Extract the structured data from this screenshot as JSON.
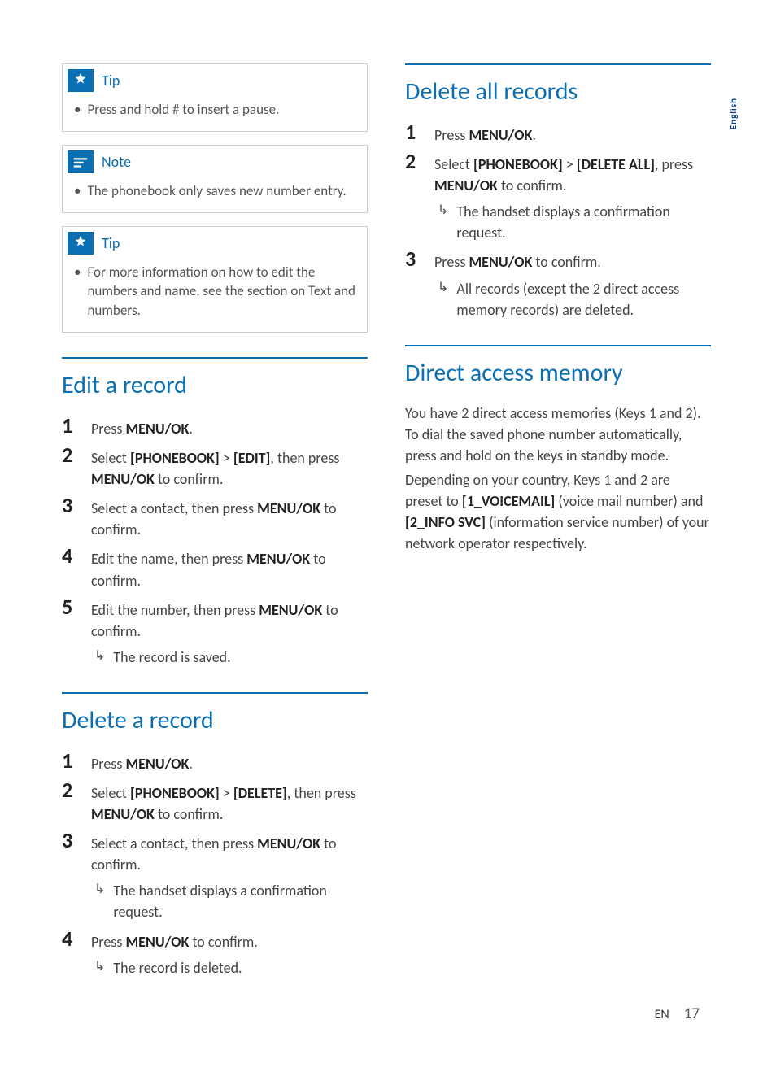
{
  "sideTab": "English",
  "callouts": {
    "tip1": {
      "label": "Tip",
      "text": "Press and hold # to insert a pause."
    },
    "note1": {
      "label": "Note",
      "text": "The phonebook only saves new number entry."
    },
    "tip2": {
      "label": "Tip",
      "text": "For more information on how to edit the numbers and name, see the section on Text and numbers."
    }
  },
  "sections": {
    "editRecord": {
      "title": "Edit a record",
      "steps": {
        "s1": {
          "pre": "Press ",
          "b1": "MENU/OK",
          "post": "."
        },
        "s2": {
          "pre": "Select ",
          "b1": "[PHONEBOOK]",
          "mid1": " > ",
          "b2": "[EDIT]",
          "mid2": ", then press ",
          "b3": "MENU/OK",
          "post": " to confirm."
        },
        "s3": {
          "pre": "Select a contact, then press ",
          "b1": "MENU/OK",
          "post": " to confirm."
        },
        "s4": {
          "pre": "Edit the name, then press ",
          "b1": "MENU/OK",
          "post": " to confirm."
        },
        "s5": {
          "pre": "Edit the number, then press ",
          "b1": "MENU/OK",
          "post": " to confirm.",
          "result": "The record is saved."
        }
      }
    },
    "deleteRecord": {
      "title": "Delete a record",
      "steps": {
        "s1": {
          "pre": "Press ",
          "b1": "MENU/OK",
          "post": "."
        },
        "s2": {
          "pre": "Select ",
          "b1": "[PHONEBOOK]",
          "mid1": " > ",
          "b2": "[DELETE]",
          "mid2": ", then press ",
          "b3": "MENU/OK",
          "post": " to confirm."
        },
        "s3": {
          "pre": "Select a contact, then press ",
          "b1": "MENU/OK",
          "post": " to confirm.",
          "result": "The handset displays a confirmation request."
        },
        "s4": {
          "pre": "Press ",
          "b1": "MENU/OK",
          "post": " to confirm.",
          "result": "The record is deleted."
        }
      }
    },
    "deleteAll": {
      "title": "Delete all records",
      "steps": {
        "s1": {
          "pre": "Press ",
          "b1": "MENU/OK",
          "post": "."
        },
        "s2": {
          "pre": "Select ",
          "b1": "[PHONEBOOK]",
          "mid1": " > ",
          "b2": "[DELETE ALL]",
          "mid2": ", press ",
          "b3": "MENU/OK",
          "post": " to confirm.",
          "result": "The handset displays a confirmation request."
        },
        "s3": {
          "pre": "Press ",
          "b1": "MENU/OK",
          "post": " to confirm.",
          "result": "All records (except the 2 direct access memory records) are deleted."
        }
      }
    },
    "directAccess": {
      "title": "Direct access memory",
      "p1": {
        "text": "You have 2 direct access memories (Keys 1 and 2). To dial the saved phone number automatically, press and hold on the keys in standby mode."
      },
      "p2": {
        "pre": "Depending on your country, Keys 1 and 2 are preset to ",
        "b1": "[1_VOICEMAIL]",
        "mid1": " (voice mail number) and ",
        "b2": "[2_INFO SVC]",
        "post": " (information service number) of your network operator respectively."
      }
    }
  },
  "footer": {
    "lang": "EN",
    "page": "17"
  },
  "glyphs": {
    "bullet": "•",
    "arrow": "↳"
  }
}
